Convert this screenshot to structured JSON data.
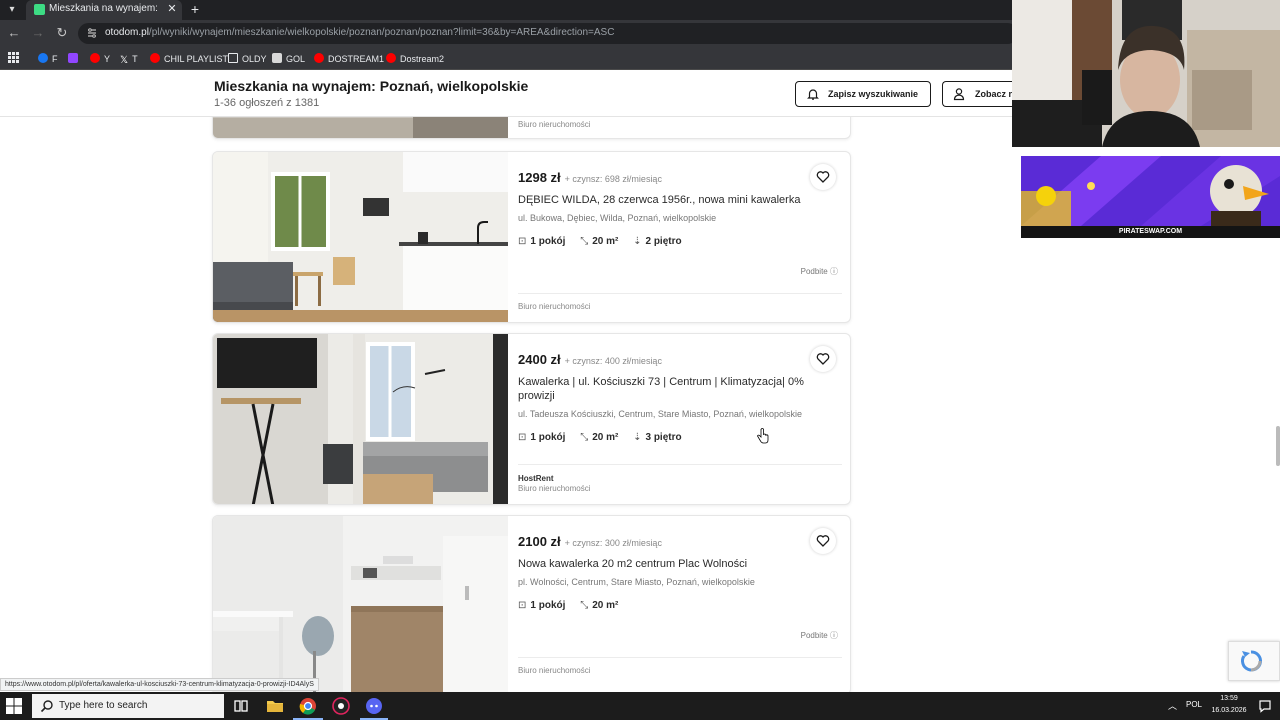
{
  "browser": {
    "tab_title": "Mieszkania na wynajem: Poznań",
    "url_domain": "otodom.pl",
    "url_path": "/pl/wyniki/wynajem/mieszkanie/wielkopolskie/poznan/poznan/poznan?limit=36&by=AREA&direction=ASC",
    "bookmarks": [
      {
        "label": "F",
        "icon": "facebook-icon",
        "color": "#1877f2"
      },
      {
        "label": "",
        "icon": "twitch-icon",
        "color": "#9146ff"
      },
      {
        "label": "Y",
        "icon": "youtube-icon",
        "color": "#ff0000"
      },
      {
        "label": "T",
        "icon": "x-icon",
        "color": "#ffffff"
      },
      {
        "label": "CHIL PLAYLIST",
        "icon": "youtube-icon",
        "color": "#ff0000"
      },
      {
        "label": "OLDY",
        "icon": "folder-icon",
        "color": "#e8eaed"
      },
      {
        "label": "GOL",
        "icon": "gol-icon",
        "color": "#d9d9d9"
      },
      {
        "label": "DOSTREAM1",
        "icon": "youtube-icon",
        "color": "#ff0000"
      },
      {
        "label": "Dostream2",
        "icon": "youtube-icon",
        "color": "#ff0000"
      }
    ]
  },
  "header": {
    "title": "Mieszkania na wynajem: Poznań, wielkopolskie",
    "subtitle": "1-36 ogłoszeń z 1381",
    "save_search_label": "Zapisz wyszukiwanie",
    "see_label": "Zobacz n"
  },
  "listings": [
    {
      "agency": "Biuro nieruchomości"
    },
    {
      "price": "1298 zł",
      "rent": "+ czynsz: 698 zł/miesiąc",
      "title": "DĘBIEC WILDA, 28 czerwca 1956r., nowa mini kawalerka",
      "address": "ul. Bukowa, Dębiec, Wilda, Poznań, wielkopolskie",
      "rooms": "1 pokój",
      "area": "20 m²",
      "floor": "2 piętro",
      "boost": "Podbite",
      "agency": "Biuro nieruchomości"
    },
    {
      "price": "2400 zł",
      "rent": "+ czynsz: 400 zł/miesiąc",
      "title": "Kawalerka | ul. Kościuszki 73 | Centrum | Klimatyzacja| 0% prowizji",
      "address": "ul. Tadeusza Kościuszki, Centrum, Stare Miasto, Poznań, wielkopolskie",
      "rooms": "1 pokój",
      "area": "20 m²",
      "floor": "3 piętro",
      "agency_name": "HostRent",
      "agency": "Biuro nieruchomości"
    },
    {
      "price": "2100 zł",
      "rent": "+ czynsz: 300 zł/miesiąc",
      "title": "Nowa kawalerka 20 m2 centrum Plac Wolności",
      "address": "pl. Wolności, Centrum, Stare Miasto, Poznań, wielkopolskie",
      "rooms": "1 pokój",
      "area": "20 m²",
      "boost": "Podbite",
      "agency": "Biuro nieruchomości"
    }
  ],
  "status_url": "https://www.otodom.pl/pl/oferta/kawalerka-ul-kosciuszki-73-centrum-klimatyzacja-0-prowizji-ID4AlyS",
  "stream": {
    "ad_footer": "PIRATESWAP.COM",
    "ad_color": "#5a2bd6"
  },
  "taskbar": {
    "search_placeholder": "Type here to search",
    "language": "POL",
    "time": "13:59",
    "date": "16.03.2026"
  },
  "colors": {
    "chrome_dark": "#202124",
    "chrome_mid": "#35363a",
    "text_primary": "#1a1a1a"
  }
}
